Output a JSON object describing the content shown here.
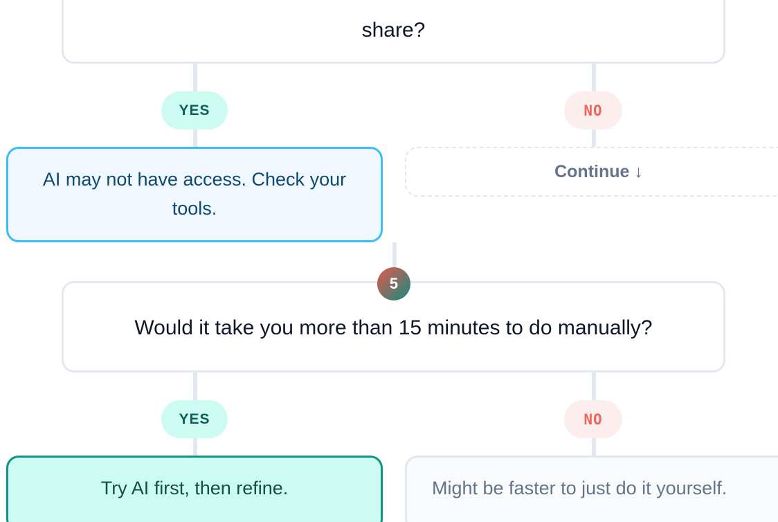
{
  "flow": {
    "top_question": {
      "text": "share?"
    },
    "top_branch": {
      "yes_label": "YES",
      "no_label": "NO",
      "yes_outcome": "AI may not have access. Check your tools.",
      "no_outcome": "Continue ↓"
    },
    "step5": {
      "number": "5",
      "question": "Would it take you more than 15 minutes to do manually?",
      "yes_label": "YES",
      "no_label": "NO",
      "yes_outcome": "Try AI first, then refine.",
      "no_outcome": "Might be faster to just do it yourself."
    }
  },
  "colors": {
    "border": "#e2e8f0",
    "yes_pill_bg": "#ccfbf1",
    "yes_pill_text": "#115e59",
    "no_pill_bg": "#fdeeee",
    "no_pill_text": "#f0645c",
    "blue_outcome_border": "#38bdf8",
    "green_outcome_border": "#0d9488"
  }
}
